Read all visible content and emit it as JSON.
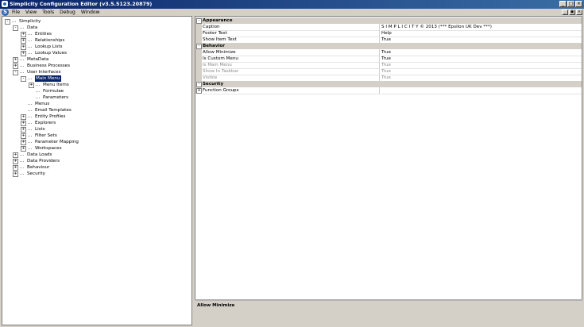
{
  "window": {
    "title": "Simplicity Configuration Editor (v3.5.5123.20879)"
  },
  "menu": [
    "File",
    "View",
    "Tools",
    "Debug",
    "Window"
  ],
  "tree": [
    {
      "label": "Simplicity",
      "level": 0,
      "expander": "-"
    },
    {
      "label": "Data",
      "level": 1,
      "expander": "-"
    },
    {
      "label": "Entities",
      "level": 2,
      "expander": "+"
    },
    {
      "label": "Relationships",
      "level": 2,
      "expander": "+"
    },
    {
      "label": "Lookup Lists",
      "level": 2,
      "expander": "+"
    },
    {
      "label": "Lookup Values",
      "level": 2,
      "expander": "+"
    },
    {
      "label": "MetaData",
      "level": 1,
      "expander": "+"
    },
    {
      "label": "Business Processes",
      "level": 1,
      "expander": "+"
    },
    {
      "label": "User Interfaces",
      "level": 1,
      "expander": "-"
    },
    {
      "label": "Main Menu",
      "level": 2,
      "expander": "-",
      "selected": true
    },
    {
      "label": "Menu Items",
      "level": 3,
      "expander": "+"
    },
    {
      "label": "Formulae",
      "level": 3,
      "expander": ""
    },
    {
      "label": "Parameters",
      "level": 3,
      "expander": ""
    },
    {
      "label": "Menus",
      "level": 2,
      "expander": ""
    },
    {
      "label": "Email Templates",
      "level": 2,
      "expander": ""
    },
    {
      "label": "Entity Profiles",
      "level": 2,
      "expander": "+"
    },
    {
      "label": "Explorers",
      "level": 2,
      "expander": "+"
    },
    {
      "label": "Lists",
      "level": 2,
      "expander": "+"
    },
    {
      "label": "Filter Sets",
      "level": 2,
      "expander": "+"
    },
    {
      "label": "Parameter Mapping",
      "level": 2,
      "expander": "+"
    },
    {
      "label": "Workspaces",
      "level": 2,
      "expander": "+"
    },
    {
      "label": "Data Loads",
      "level": 1,
      "expander": "+"
    },
    {
      "label": "Data Providers",
      "level": 1,
      "expander": "+"
    },
    {
      "label": "Behaviour",
      "level": 1,
      "expander": "+"
    },
    {
      "label": "Security",
      "level": 1,
      "expander": "+"
    }
  ],
  "properties": [
    {
      "kind": "category",
      "label": "Appearance",
      "expander": "-"
    },
    {
      "kind": "prop",
      "name": "Caption",
      "value": "S I M P L I C I T Y  © 2013 (*** Epsilon UK Dev ***)"
    },
    {
      "kind": "prop",
      "name": "Footer Text",
      "value": "Help"
    },
    {
      "kind": "prop",
      "name": "Show Item Text",
      "value": "True"
    },
    {
      "kind": "category",
      "label": "Behavior",
      "expander": "-"
    },
    {
      "kind": "prop",
      "name": "Allow Minimize",
      "value": "True"
    },
    {
      "kind": "prop",
      "name": "Is Custom Menu",
      "value": "True"
    },
    {
      "kind": "prop",
      "name": "Is Main Menu",
      "value": "True",
      "disabled": true
    },
    {
      "kind": "prop",
      "name": "Show In Taskbar",
      "value": "True",
      "disabled": true
    },
    {
      "kind": "prop",
      "name": "Visible",
      "value": "True",
      "disabled": true
    },
    {
      "kind": "category",
      "label": "Security",
      "expander": "-"
    },
    {
      "kind": "prop",
      "name": "Function Groups",
      "value": "",
      "expander": "+"
    }
  ],
  "description": {
    "title": "Allow Minimize"
  },
  "titlebar_buttons": [
    "_",
    "□",
    "×"
  ],
  "mdi_buttons": [
    "_",
    "▣",
    "×"
  ]
}
